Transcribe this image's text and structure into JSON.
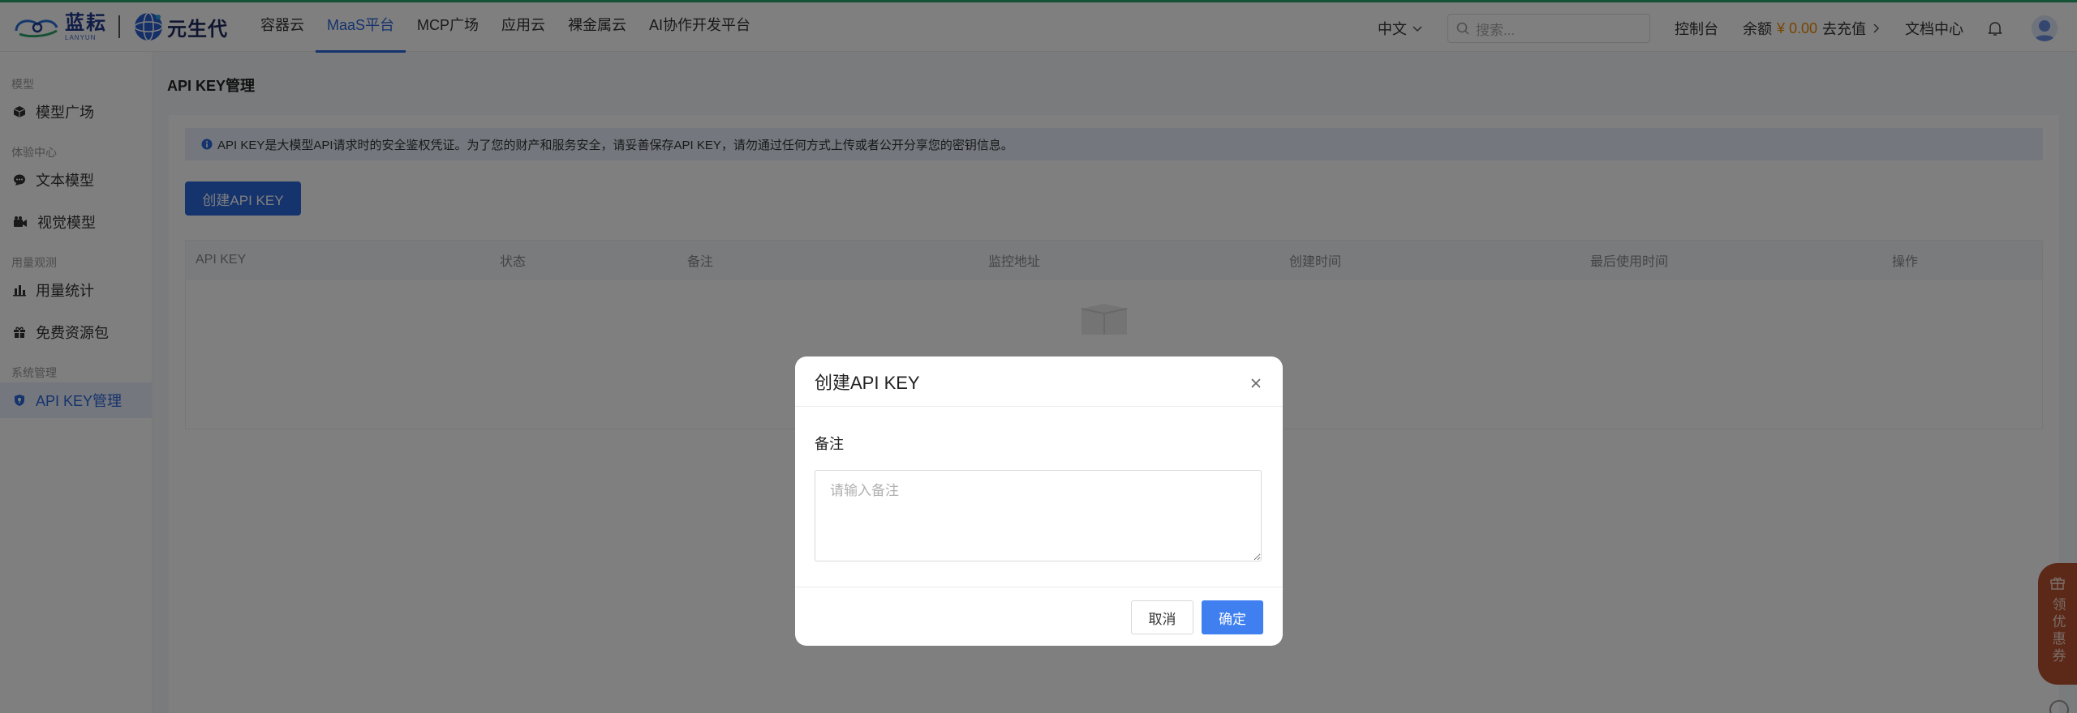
{
  "brand": {
    "lanyun_cn": "蓝耘",
    "lanyun_en": "LANYUN",
    "partner_cn": "元生代"
  },
  "nav": {
    "items": [
      {
        "label": "容器云"
      },
      {
        "label": "MaaS平台"
      },
      {
        "label": "MCP广场"
      },
      {
        "label": "应用云"
      },
      {
        "label": "裸金属云"
      },
      {
        "label": "AI协作开发平台"
      }
    ],
    "active_index": 1
  },
  "topright": {
    "lang": "中文",
    "search_placeholder": "搜索...",
    "console": "控制台",
    "balance_label": "余额",
    "balance_amount": "¥ 0.00",
    "recharge": "去充值",
    "docs": "文档中心"
  },
  "sidebar": {
    "groups": [
      {
        "title": "模型",
        "items": [
          {
            "label": "模型广场",
            "icon": "cube-icon"
          }
        ]
      },
      {
        "title": "体验中心",
        "items": [
          {
            "label": "文本模型",
            "icon": "chat-icon"
          },
          {
            "label": "视觉模型",
            "icon": "video-camera-icon"
          }
        ]
      },
      {
        "title": "用量观测",
        "items": [
          {
            "label": "用量统计",
            "icon": "bar-chart-icon"
          },
          {
            "label": "免费资源包",
            "icon": "gift-icon"
          }
        ]
      },
      {
        "title": "系统管理",
        "items": [
          {
            "label": "API KEY管理",
            "icon": "shield-icon"
          }
        ]
      }
    ]
  },
  "page": {
    "title": "API KEY管理",
    "notice": "API KEY是大模型API请求时的安全鉴权凭证。为了您的财产和服务安全，请妥善保存API KEY，请勿通过任何方式上传或者公开分享您的密钥信息。",
    "create_button": "创建API KEY",
    "table_headers": [
      "API KEY",
      "状态",
      "备注",
      "监控地址",
      "创建时间",
      "最后使用时间",
      "操作"
    ]
  },
  "modal": {
    "title": "创建API KEY",
    "field_label": "备注",
    "placeholder": "请输入备注",
    "value": "",
    "cancel": "取消",
    "confirm": "确定"
  },
  "coupon": {
    "label": "领优惠券"
  },
  "colors": {
    "accent": "#2b66d9",
    "confirm": "#3f7ff0",
    "balance": "#f08a00",
    "coupon": "#b8502f"
  }
}
